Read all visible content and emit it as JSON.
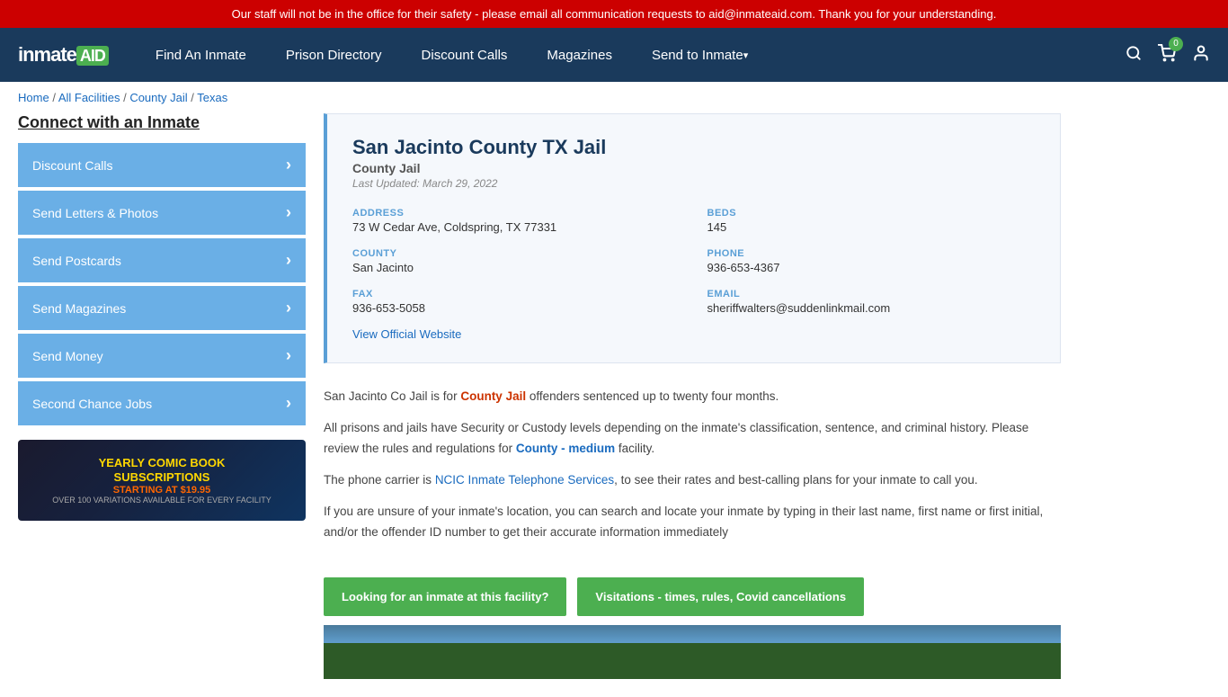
{
  "alert": {
    "text": "Our staff will not be in the office for their safety - please email all communication requests to aid@inmateaid.com. Thank you for your understanding."
  },
  "navbar": {
    "brand": "inmateAID",
    "links": [
      {
        "label": "Find An Inmate",
        "id": "find-inmate"
      },
      {
        "label": "Prison Directory",
        "id": "prison-directory"
      },
      {
        "label": "Discount Calls",
        "id": "discount-calls"
      },
      {
        "label": "Magazines",
        "id": "magazines"
      },
      {
        "label": "Send to Inmate",
        "id": "send-to-inmate",
        "dropdown": true
      }
    ],
    "cart_count": "0"
  },
  "breadcrumb": {
    "items": [
      "Home",
      "All Facilities",
      "County Jail",
      "Texas"
    ]
  },
  "sidebar": {
    "title": "Connect with an Inmate",
    "buttons": [
      {
        "label": "Discount Calls",
        "id": "discount-calls-btn"
      },
      {
        "label": "Send Letters & Photos",
        "id": "send-letters-btn"
      },
      {
        "label": "Send Postcards",
        "id": "send-postcards-btn"
      },
      {
        "label": "Send Magazines",
        "id": "send-magazines-btn"
      },
      {
        "label": "Send Money",
        "id": "send-money-btn"
      },
      {
        "label": "Second Chance Jobs",
        "id": "second-chance-btn"
      }
    ],
    "ad": {
      "title": "YEARLY COMIC BOOK\nSUBSCRIPTIONS",
      "subtitle": "STARTING AT $19.95",
      "small": "OVER 100 VARIATIONS AVAILABLE FOR EVERY FACILITY"
    }
  },
  "facility": {
    "name": "San Jacinto County TX Jail",
    "type": "County Jail",
    "last_updated": "Last Updated: March 29, 2022",
    "address_label": "ADDRESS",
    "address_value": "73 W Cedar Ave, Coldspring, TX 77331",
    "beds_label": "BEDS",
    "beds_value": "145",
    "county_label": "COUNTY",
    "county_value": "San Jacinto",
    "phone_label": "PHONE",
    "phone_value": "936-653-4367",
    "fax_label": "FAX",
    "fax_value": "936-653-5058",
    "email_label": "EMAIL",
    "email_value": "sheriffwalters@suddenlinkmail.com",
    "website_link": "View Official Website",
    "desc1": "San Jacinto Co Jail is for County Jail offenders sentenced up to twenty four months.",
    "desc2": "All prisons and jails have Security or Custody levels depending on the inmate's classification, sentence, and criminal history. Please review the rules and regulations for County - medium facility.",
    "desc3": "The phone carrier is NCIC Inmate Telephone Services, to see their rates and best-calling plans for your inmate to call you.",
    "desc4": "If you are unsure of your inmate's location, you can search and locate your inmate by typing in their last name, first name or first initial, and/or the offender ID number to get their accurate information immediately",
    "cta1": "Looking for an inmate at this facility?",
    "cta2": "Visitations - times, rules, Covid cancellations"
  }
}
